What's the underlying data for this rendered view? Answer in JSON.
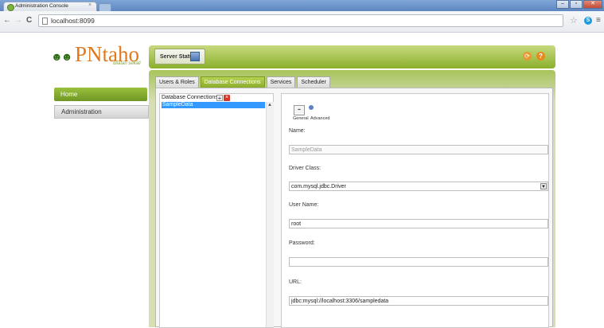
{
  "browser": {
    "tab_title": "Administration Console",
    "tab_close": "×",
    "url": "localhost:8099",
    "back": "←",
    "forward": "→",
    "reload": "C",
    "star": "☆",
    "menu": "≡",
    "minimize": "–",
    "maximize": "▫",
    "close": "✕"
  },
  "logo": {
    "text": "PNtaho",
    "tagline": "bilatan sekali",
    "heads": "☻☻"
  },
  "nav": {
    "home": "Home",
    "administration": "Administration"
  },
  "header": {
    "server_status_label": "Server Status:",
    "refresh_glyph": "⟳",
    "help_glyph": "?"
  },
  "tabs": [
    "Users & Roles",
    "Database Connections",
    "Services",
    "Scheduler"
  ],
  "active_tab": "Database Connections",
  "connections": {
    "header": "Database Connections",
    "add_glyph": "+",
    "remove_glyph": "×",
    "items": [
      "SampleData"
    ]
  },
  "detail": {
    "subtab_general": "General",
    "subtab_advanced": "Advanced",
    "name_label": "Name:",
    "name_value": "SampleData",
    "driver_label": "Driver Class:",
    "driver_value": "com.mysql.jdbc.Driver",
    "user_label": "User Name:",
    "user_value": "root",
    "password_label": "Password:",
    "password_value": "",
    "url_label": "URL:",
    "url_value": "jdbc:mysql://localhost:3306/sampledata"
  }
}
